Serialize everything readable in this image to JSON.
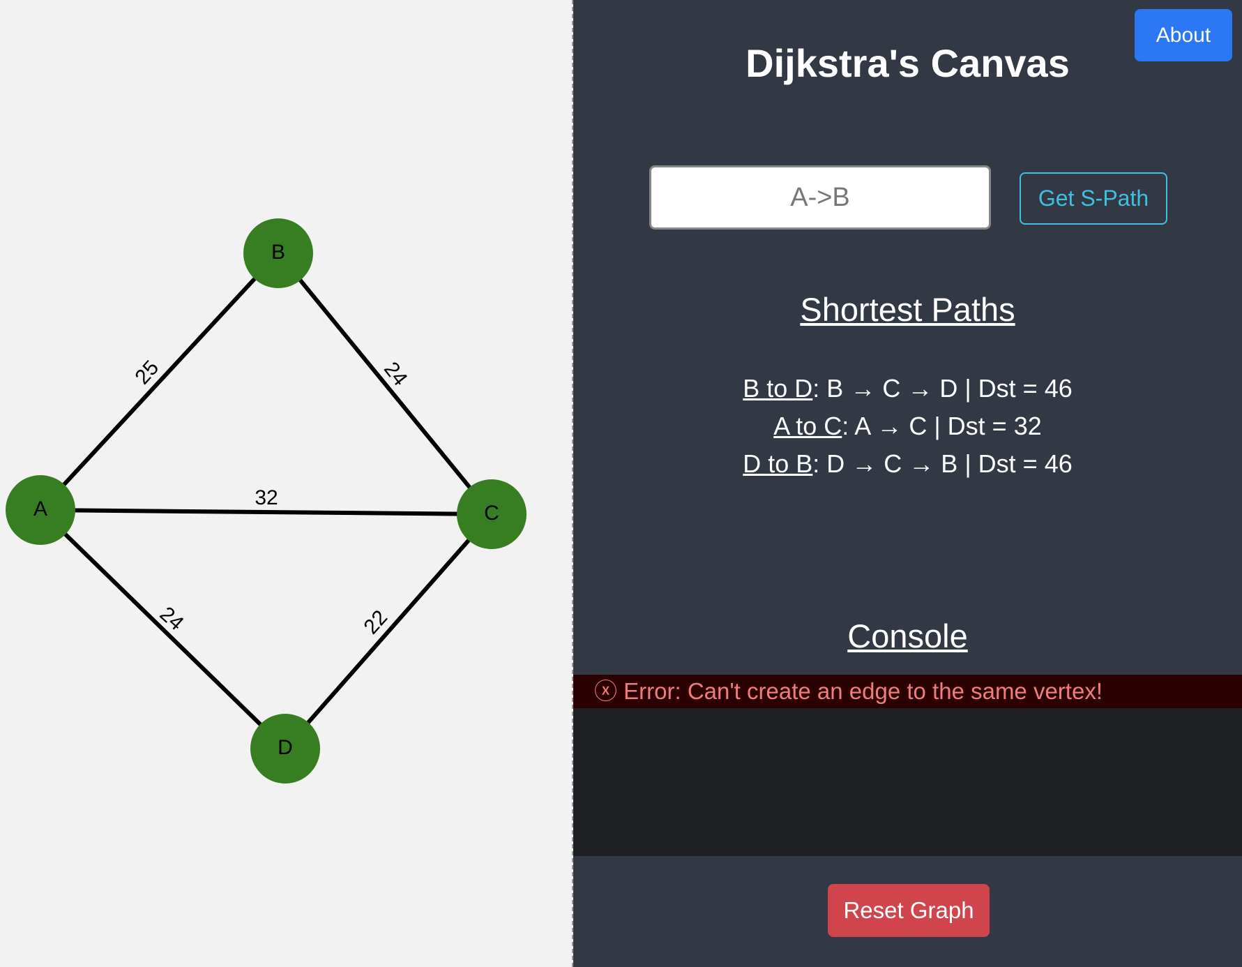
{
  "graph": {
    "vertices": [
      {
        "id": "A",
        "label": "A"
      },
      {
        "id": "B",
        "label": "B"
      },
      {
        "id": "C",
        "label": "C"
      },
      {
        "id": "D",
        "label": "D"
      }
    ],
    "edges": [
      {
        "from": "A",
        "to": "B",
        "weight": "25"
      },
      {
        "from": "B",
        "to": "C",
        "weight": "24"
      },
      {
        "from": "A",
        "to": "C",
        "weight": "32"
      },
      {
        "from": "A",
        "to": "D",
        "weight": "24"
      },
      {
        "from": "D",
        "to": "C",
        "weight": "22"
      }
    ],
    "vertex_color": "#377d22",
    "edge_color": "#000000"
  },
  "panel": {
    "about_label": "About",
    "title": "Dijkstra's Canvas",
    "path_input": {
      "value": "",
      "placeholder": "A->B"
    },
    "get_path_label": "Get S-Path",
    "shortest_heading": "Shortest Paths",
    "paths": [
      {
        "pair": "B to D",
        "detail": ": B → C → D | Dst = 46"
      },
      {
        "pair": "A to C",
        "detail": ": A → C | Dst = 32"
      },
      {
        "pair": "D to B",
        "detail": ": D → C → B | Dst = 46"
      }
    ],
    "console_heading": "Console",
    "console_messages": [
      {
        "type": "error",
        "icon": "ⓧ",
        "text": "Error: Can't create an edge to the same vertex!"
      }
    ],
    "reset_label": "Reset Graph"
  },
  "colors": {
    "panel_bg": "#323944",
    "about_button": "#2c77f4",
    "get_path_accent": "#3fc0e0",
    "error_text": "#f07d7d",
    "error_bg": "#2b0000",
    "reset_button": "#d0444b"
  }
}
